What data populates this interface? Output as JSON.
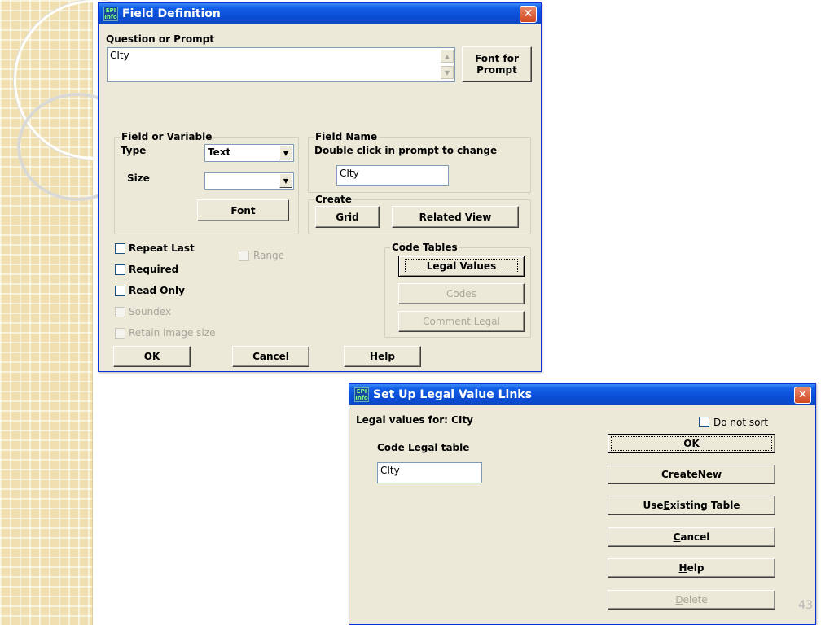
{
  "slide": {
    "page_number": "43"
  },
  "field_definition": {
    "title": "Field Definition",
    "close_glyph": "✕",
    "app_icon_text": "EPI Info",
    "question_label": "Question or Prompt",
    "question_value": "CIty",
    "font_for_prompt_line1": "Font for",
    "font_for_prompt_line2": "Prompt",
    "field_or_variable": {
      "group_title": "Field or Variable",
      "type_label": "Type",
      "type_value": "Text",
      "size_label": "Size",
      "size_value": "",
      "font_button": "Font"
    },
    "field_name": {
      "group_title": "Field Name",
      "instruction": "Double click in prompt to change",
      "value": "CIty"
    },
    "create": {
      "group_title": "Create",
      "grid_button": "Grid",
      "related_view_button": "Related View"
    },
    "checkboxes": {
      "repeat_last": "Repeat Last",
      "required": "Required",
      "read_only": "Read Only",
      "soundex": "Soundex",
      "retain_image_size": "Retain image size",
      "range": "Range"
    },
    "code_tables": {
      "group_title": "Code Tables",
      "legal_values_button": "Legal Values",
      "codes_button": "Codes",
      "comment_legal_button": "Comment Legal"
    },
    "ok_button": "OK",
    "cancel_button": "Cancel",
    "help_button": "Help"
  },
  "legal_value_links": {
    "title": "Set Up Legal Value Links",
    "close_glyph": "✕",
    "app_icon_text": "EPI Info",
    "legal_values_for_label": "Legal values for:",
    "legal_values_for_value": "CIty",
    "do_not_sort_label": "Do not sort",
    "code_legal_table_label": "Code Legal table",
    "code_legal_table_value": "CIty",
    "ok_button": "OK",
    "create_new_prefix": "Create ",
    "create_new_underlined": "N",
    "create_new_suffix": "ew",
    "use_existing_prefix": "Use ",
    "use_existing_underlined": "E",
    "use_existing_suffix": "xisting Table",
    "cancel_underlined": "C",
    "cancel_suffix": "ancel",
    "help_underlined": "H",
    "help_suffix": "elp",
    "delete_underlined": "D",
    "delete_suffix": "elete"
  }
}
